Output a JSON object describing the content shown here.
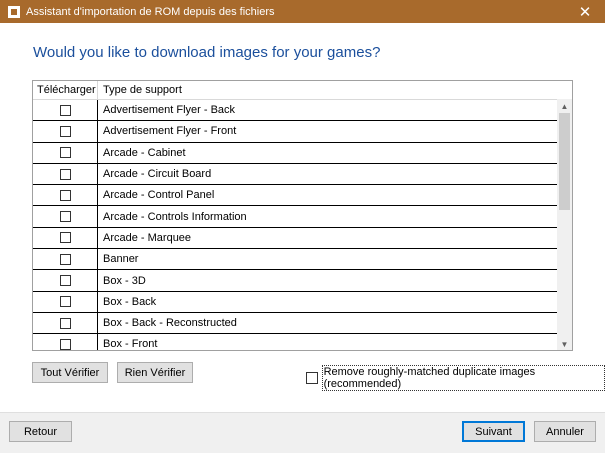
{
  "window": {
    "title": "Assistant d'importation de ROM depuis des fichiers",
    "close_glyph": "✕"
  },
  "heading": "Would you like to download images for your games?",
  "grid": {
    "columns": [
      "Télécharger",
      "Type de support"
    ],
    "rows": [
      {
        "label": "Advertisement Flyer - Back",
        "checked": false
      },
      {
        "label": "Advertisement Flyer - Front",
        "checked": false
      },
      {
        "label": "Arcade - Cabinet",
        "checked": false
      },
      {
        "label": "Arcade - Circuit Board",
        "checked": false
      },
      {
        "label": "Arcade - Control Panel",
        "checked": false
      },
      {
        "label": "Arcade - Controls Information",
        "checked": false
      },
      {
        "label": "Arcade - Marquee",
        "checked": false
      },
      {
        "label": "Banner",
        "checked": false
      },
      {
        "label": "Box - 3D",
        "checked": false
      },
      {
        "label": "Box - Back",
        "checked": false
      },
      {
        "label": "Box - Back - Reconstructed",
        "checked": false
      },
      {
        "label": "Box - Front",
        "checked": false
      }
    ]
  },
  "buttons": {
    "check_all": "Tout Vérifier",
    "check_none": "Rien Vérifier",
    "back": "Retour",
    "next": "Suivant",
    "cancel": "Annuler"
  },
  "dedupe": {
    "label": "Remove roughly-matched duplicate images (recommended)",
    "checked": false
  },
  "colors": {
    "titlebar": "#a86a2c",
    "heading": "#1b4f9c",
    "accent": "#0078d7"
  },
  "icons": {
    "scroll_up": "▲",
    "scroll_down": "▼"
  }
}
